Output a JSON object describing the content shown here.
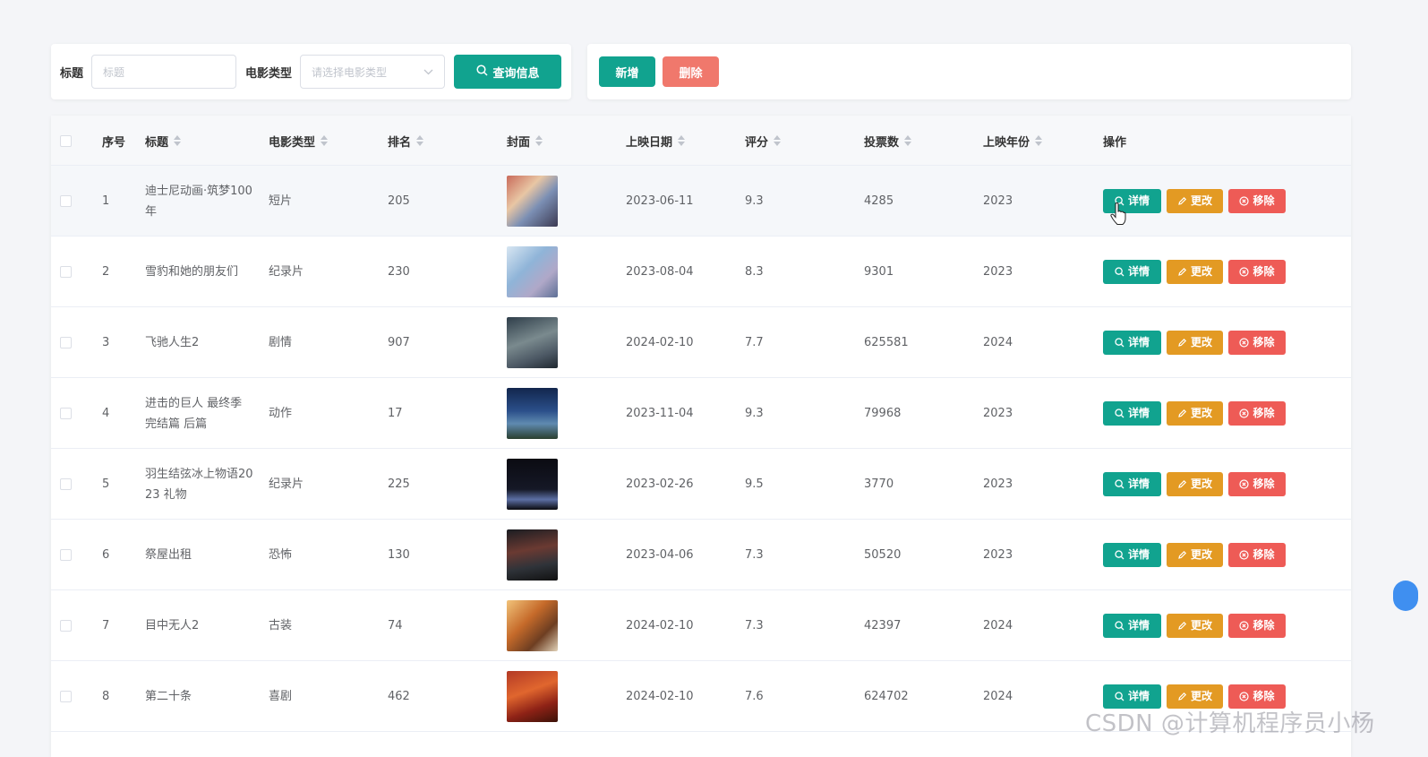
{
  "search": {
    "title_label": "标题",
    "title_placeholder": "标题",
    "type_label": "电影类型",
    "type_placeholder": "请选择电影类型",
    "query_button": "查询信息"
  },
  "actions": {
    "add_button": "新增",
    "delete_button": "删除"
  },
  "table": {
    "headers": {
      "index": "序号",
      "title": "标题",
      "type": "电影类型",
      "rank": "排名",
      "cover": "封面",
      "release_date": "上映日期",
      "score": "评分",
      "votes": "投票数",
      "year": "上映年份",
      "ops": "操作"
    },
    "op_labels": {
      "detail": "详情",
      "edit": "更改",
      "remove": "移除"
    },
    "rows": [
      {
        "index": "1",
        "title": "迪士尼动画·筑梦100年",
        "type": "短片",
        "rank": "205",
        "date": "2023-06-11",
        "score": "9.3",
        "votes": "4285",
        "year": "2023"
      },
      {
        "index": "2",
        "title": "雪豹和她的朋友们",
        "type": "纪录片",
        "rank": "230",
        "date": "2023-08-04",
        "score": "8.3",
        "votes": "9301",
        "year": "2023"
      },
      {
        "index": "3",
        "title": "飞驰人生2",
        "type": "剧情",
        "rank": "907",
        "date": "2024-02-10",
        "score": "7.7",
        "votes": "625581",
        "year": "2024"
      },
      {
        "index": "4",
        "title": "进击的巨人 最终季 完结篇 后篇",
        "type": "动作",
        "rank": "17",
        "date": "2023-11-04",
        "score": "9.3",
        "votes": "79968",
        "year": "2023"
      },
      {
        "index": "5",
        "title": "羽生结弦冰上物语2023 礼物",
        "type": "纪录片",
        "rank": "225",
        "date": "2023-02-26",
        "score": "9.5",
        "votes": "3770",
        "year": "2023"
      },
      {
        "index": "6",
        "title": "祭屋出租",
        "type": "恐怖",
        "rank": "130",
        "date": "2023-04-06",
        "score": "7.3",
        "votes": "50520",
        "year": "2023"
      },
      {
        "index": "7",
        "title": "目中无人2",
        "type": "古装",
        "rank": "74",
        "date": "2024-02-10",
        "score": "7.3",
        "votes": "42397",
        "year": "2024"
      },
      {
        "index": "8",
        "title": "第二十条",
        "type": "喜剧",
        "rank": "462",
        "date": "2024-02-10",
        "score": "7.6",
        "votes": "624702",
        "year": "2024"
      }
    ]
  },
  "colors": {
    "primary": "#11a38f",
    "warning": "#e39a23",
    "danger": "#ee5b56",
    "delete": "#f0786c"
  },
  "watermark": "CSDN @计算机程序员小杨"
}
